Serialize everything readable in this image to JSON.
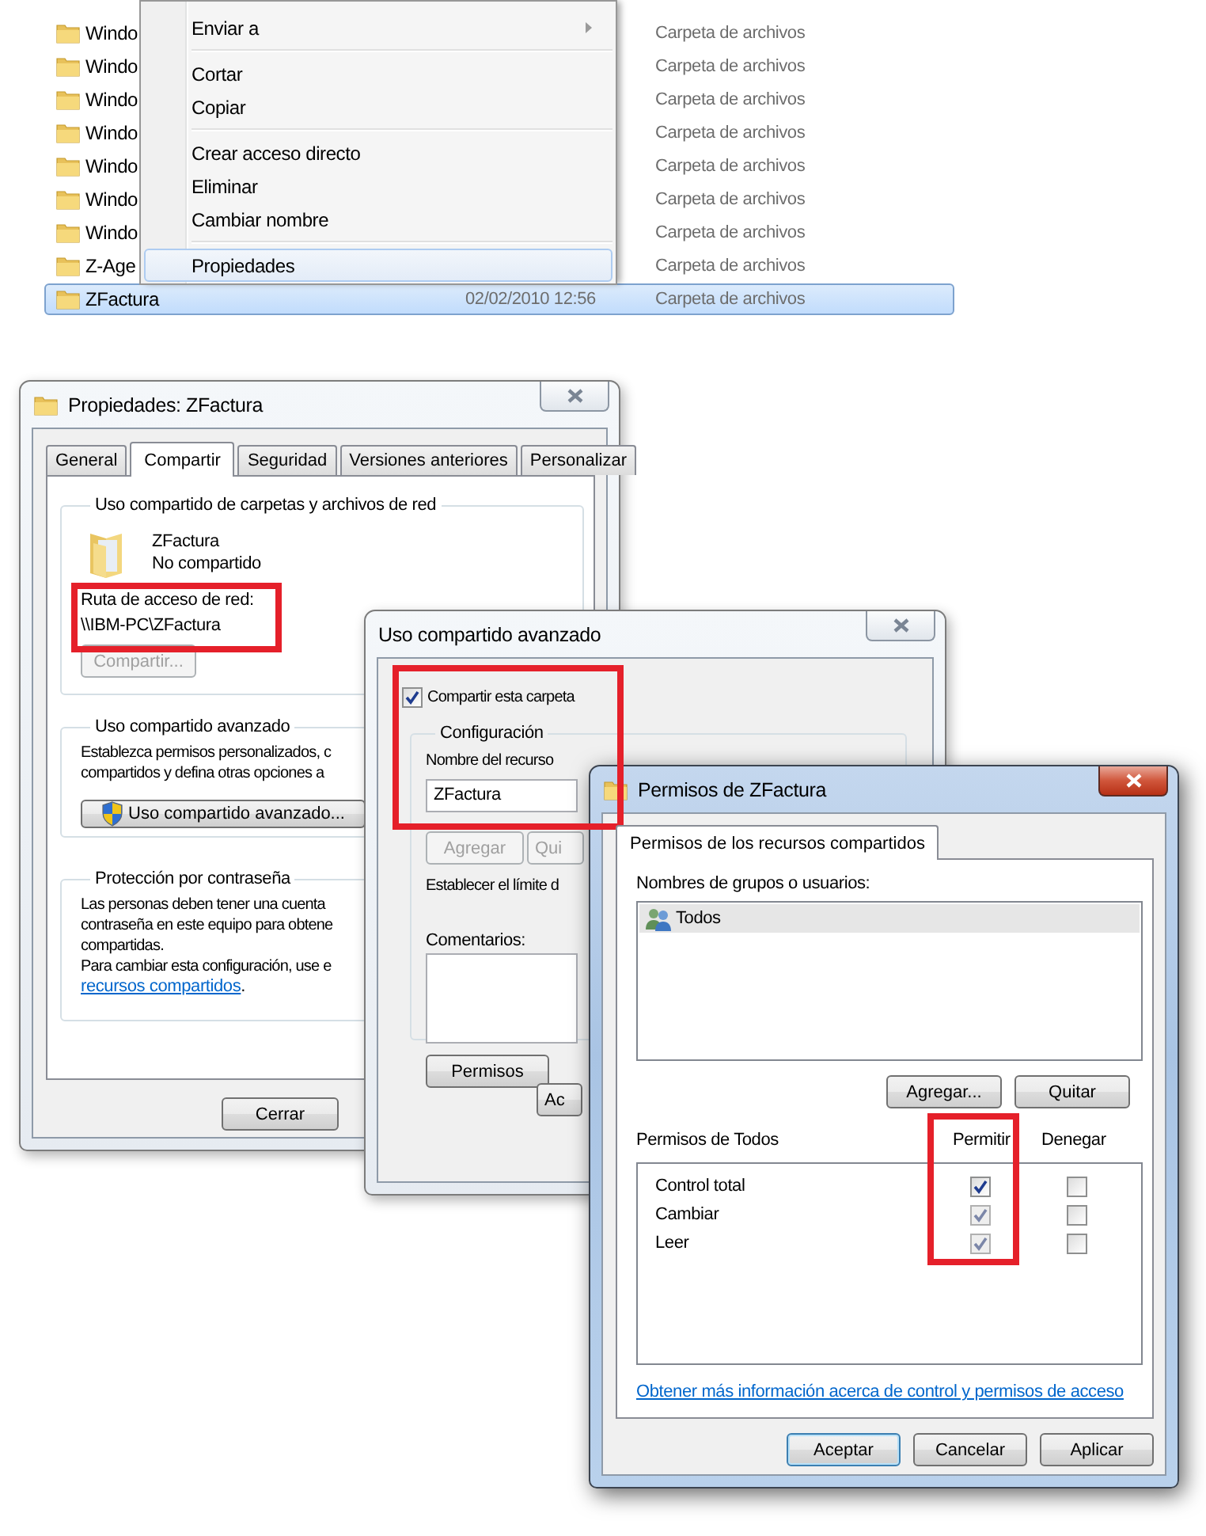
{
  "file_list": {
    "rows": [
      {
        "name": "Windo",
        "type": "Carpeta de archivos",
        "selected": false
      },
      {
        "name": "Windo",
        "type": "Carpeta de archivos",
        "selected": false
      },
      {
        "name": "Windo",
        "type": "Carpeta de archivos",
        "selected": false
      },
      {
        "name": "Windo",
        "type": "Carpeta de archivos",
        "selected": false
      },
      {
        "name": "Windo",
        "type": "Carpeta de archivos",
        "selected": false
      },
      {
        "name": "Windo",
        "type": "Carpeta de archivos",
        "selected": false
      },
      {
        "name": "Windo",
        "type": "Carpeta de archivos",
        "selected": false
      },
      {
        "name": "Z-Age",
        "type": "Carpeta de archivos",
        "selected": false
      },
      {
        "name": "ZFactura",
        "date": "02/02/2010 12:56",
        "type": "Carpeta de archivos",
        "selected": true
      }
    ]
  },
  "context_menu": {
    "items": [
      {
        "kind": "item",
        "label": "Enviar a",
        "submenu": true,
        "selected": false
      },
      {
        "kind": "separator"
      },
      {
        "kind": "item",
        "label": "Cortar",
        "submenu": false,
        "selected": false
      },
      {
        "kind": "item",
        "label": "Copiar",
        "submenu": false,
        "selected": false
      },
      {
        "kind": "separator"
      },
      {
        "kind": "item",
        "label": "Crear acceso directo",
        "submenu": false,
        "selected": false
      },
      {
        "kind": "item",
        "label": "Eliminar",
        "submenu": false,
        "selected": false
      },
      {
        "kind": "item",
        "label": "Cambiar nombre",
        "submenu": false,
        "selected": false
      },
      {
        "kind": "separator"
      },
      {
        "kind": "item",
        "label": "Propiedades",
        "submenu": false,
        "selected": true
      }
    ]
  },
  "properties_dialog": {
    "title": "Propiedades: ZFactura",
    "active": false,
    "tabs": [
      {
        "label": "General",
        "selected": false
      },
      {
        "label": "Compartir",
        "selected": true
      },
      {
        "label": "Seguridad",
        "selected": false
      },
      {
        "label": "Versiones anteriores",
        "selected": false
      },
      {
        "label": "Personalizar",
        "selected": false
      }
    ],
    "network_group": {
      "title": "Uso compartido de carpetas y archivos de red",
      "folder_name": "ZFactura",
      "status": "No compartido",
      "path_label": "Ruta de acceso de red:",
      "path_value": "\\\\IBM-PC\\ZFactura",
      "share_button": {
        "label": "Compartir...",
        "disabled": true
      }
    },
    "advanced_group": {
      "title": "Uso compartido avanzado",
      "lines": [
        "Establezca permisos personalizados, c",
        "compartidos y defina otras opciones a"
      ],
      "button": "Uso compartido avanzado..."
    },
    "password_group": {
      "title": "Protección por contraseña",
      "lines": [
        "Las personas deben tener una cuenta",
        "contraseña en este equipo para obtene",
        "compartidas.",
        "Para cambiar esta configuración, use e"
      ],
      "link": "recursos compartidos",
      "link_tail": "."
    },
    "buttons": [
      "Cerrar"
    ]
  },
  "advanced_dialog": {
    "title": "Uso compartido avanzado",
    "active": false,
    "share_checkbox": {
      "label": "Compartir esta carpeta",
      "checked": true
    },
    "config_group": {
      "title": "Configuración",
      "share_name_label": "Nombre del recurso",
      "share_name_value": "ZFactura",
      "buttons": [
        {
          "label": "Agregar",
          "disabled": true
        },
        {
          "label": "Qui",
          "disabled": true
        }
      ],
      "limit_label": "Establecer el límite d",
      "comments_label": "Comentarios:",
      "permissions_button": "Permisos"
    },
    "buttons": [
      "Ac"
    ]
  },
  "permissions_dialog": {
    "title": "Permisos de ZFactura",
    "active": true,
    "tabs": [
      {
        "label": "Permisos de los recursos compartidos",
        "selected": true
      }
    ],
    "users_label": "Nombres de grupos o usuarios:",
    "users": [
      {
        "name": "Todos",
        "selected": true
      }
    ],
    "user_buttons": [
      "Agregar...",
      "Quitar"
    ],
    "permissions_label": "Permisos de Todos",
    "allow_heading": "Permitir",
    "deny_heading": "Denegar",
    "permissions": [
      {
        "name": "Control total",
        "allow": {
          "checked": true,
          "disabled": false
        },
        "deny": {
          "checked": false,
          "disabled": false
        }
      },
      {
        "name": "Cambiar",
        "allow": {
          "checked": true,
          "disabled": true
        },
        "deny": {
          "checked": false,
          "disabled": false
        }
      },
      {
        "name": "Leer",
        "allow": {
          "checked": true,
          "disabled": true
        },
        "deny": {
          "checked": false,
          "disabled": false
        }
      }
    ],
    "info_link": "Obtener más información acerca de control y permisos de acceso",
    "buttons": [
      {
        "label": "Aceptar",
        "default": true
      },
      {
        "label": "Cancelar",
        "default": false
      },
      {
        "label": "Aplicar",
        "default": false
      }
    ]
  }
}
